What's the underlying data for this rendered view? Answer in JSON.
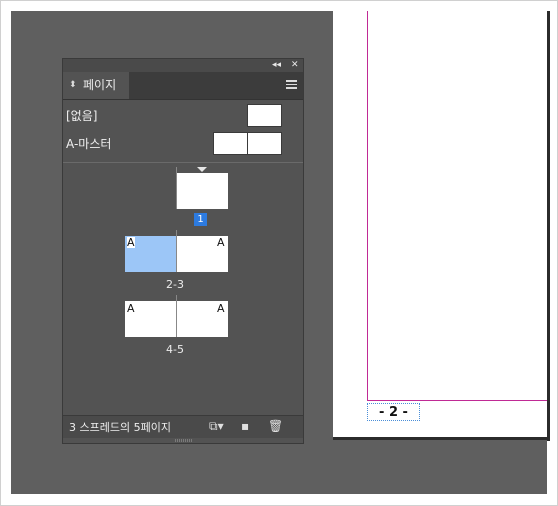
{
  "document": {
    "page_number_marker": "- 2 -"
  },
  "panel": {
    "collapse_icon": "collapse-double-arrow-icon",
    "close_icon": "close-icon",
    "tab": {
      "label": "페이지",
      "icon": "chevron-updown-icon"
    },
    "menu_icon": "hamburger-menu-icon",
    "masters": [
      {
        "label": "[없음]"
      },
      {
        "label": "A-마스터"
      }
    ],
    "pages": {
      "spread_1": {
        "label": "1",
        "selected": true
      },
      "spread_2": {
        "label": "2-3",
        "left_master": "A",
        "right_master": "A",
        "left_page_highlighted": true
      },
      "spread_3": {
        "label": "4-5",
        "left_master": "A",
        "right_master": "A"
      }
    },
    "footer": {
      "status": "3 스프레드의 5페이지",
      "edit_page_size_icon": "page-size-icon",
      "new_page_icon": "new-page-icon",
      "delete_icon": "trash-icon"
    }
  },
  "colors": {
    "selection": "#2d7be0",
    "highlight_page": "#9cc6f7",
    "margin_guide": "#c02a95"
  }
}
